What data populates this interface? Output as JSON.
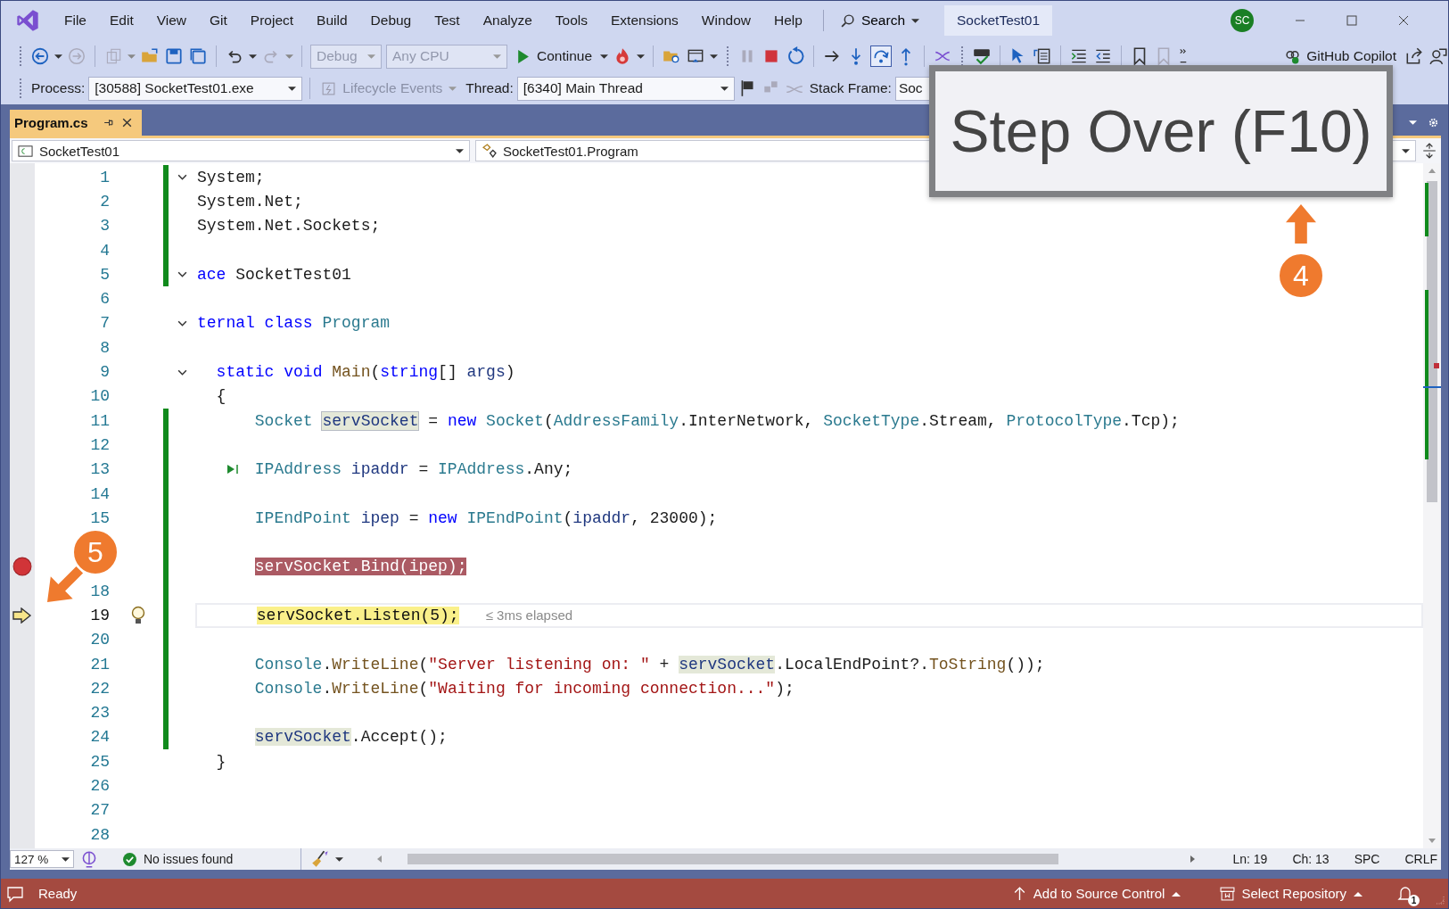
{
  "menu_bar": {
    "items": [
      "File",
      "Edit",
      "View",
      "Git",
      "Project",
      "Build",
      "Debug",
      "Test",
      "Analyze",
      "Tools",
      "Extensions",
      "Window",
      "Help"
    ],
    "search": "Search",
    "solution_name": "SocketTest01",
    "avatar": "SC"
  },
  "toolbar": {
    "configuration": {
      "text": "Debug",
      "disabled": true
    },
    "platform": {
      "text": "Any CPU",
      "disabled": true
    },
    "continue": "Continue",
    "copilot": "GitHub Copilot"
  },
  "debug_location": {
    "process_label": "Process:",
    "process": "[30588] SocketTest01.exe",
    "lifecycle": {
      "text": "Lifecycle Events",
      "disabled": true
    },
    "thread_label": "Thread:",
    "thread": "[6340] Main Thread",
    "stack_frame_label": "Stack Frame:",
    "stack_frame": "Soc"
  },
  "tabs": [
    {
      "label": "Program.cs",
      "selected": true
    }
  ],
  "navigation": {
    "project": "SocketTest01",
    "type": "SocketTest01.Program"
  },
  "lines": [
    {
      "number": "1",
      "fold": true,
      "changed": true,
      "tokens": [
        {
          "t": "System;"
        }
      ]
    },
    {
      "number": "2",
      "changed": true,
      "tokens": [
        {
          "t": "System.Net;"
        }
      ]
    },
    {
      "number": "3",
      "changed": true,
      "tokens": [
        {
          "t": "System.Net.Sockets;"
        }
      ]
    },
    {
      "number": "4",
      "changed": true
    },
    {
      "number": "5",
      "fold": true,
      "changed": true,
      "tokens": [
        {
          "t": "ace ",
          "kind": "kw"
        },
        {
          "t": "SocketTest01"
        }
      ]
    },
    {
      "number": "6"
    },
    {
      "number": "7",
      "fold": true,
      "tokens": [
        {
          "t": "ternal class ",
          "kind": "kw"
        },
        {
          "t": "Program",
          "kind": "type"
        }
      ]
    },
    {
      "number": "8"
    },
    {
      "number": "9",
      "fold": true,
      "tokens": [
        {
          "t": "  static void ",
          "kind": "kw"
        },
        {
          "t": "Main",
          "kind": "method"
        },
        {
          "t": "("
        },
        {
          "t": "string",
          "kind": "kw"
        },
        {
          "t": "[] "
        },
        {
          "t": "args",
          "kind": "var"
        },
        {
          "t": ")"
        }
      ]
    },
    {
      "number": "10",
      "tokens": [
        {
          "t": "  {"
        }
      ]
    },
    {
      "number": "11",
      "changed": true,
      "tokens": [
        {
          "t": "      Socket ",
          "kind": "type"
        },
        {
          "t": "servSocket",
          "kind": "def"
        },
        {
          "t": " = "
        },
        {
          "t": "new ",
          "kind": "kw"
        },
        {
          "t": "Socket",
          "kind": "type"
        },
        {
          "t": "("
        },
        {
          "t": "AddressFamily",
          "kind": "type"
        },
        {
          "t": ".InterNetwork, "
        },
        {
          "t": "SocketType",
          "kind": "type"
        },
        {
          "t": ".Stream, "
        },
        {
          "t": "ProtocolType",
          "kind": "type"
        },
        {
          "t": ".Tcp);"
        }
      ]
    },
    {
      "number": "12",
      "changed": true
    },
    {
      "number": "13",
      "changed": true,
      "run_to_click": true,
      "tokens": [
        {
          "t": "      IPAddress ",
          "kind": "type"
        },
        {
          "t": "ipaddr",
          "kind": "var"
        },
        {
          "t": " = "
        },
        {
          "t": "IPAddress",
          "kind": "type"
        },
        {
          "t": ".Any;"
        }
      ]
    },
    {
      "number": "14",
      "changed": true
    },
    {
      "number": "15",
      "changed": true,
      "tokens": [
        {
          "t": "      IPEndPoint ",
          "kind": "type"
        },
        {
          "t": "ipep",
          "kind": "var"
        },
        {
          "t": " = "
        },
        {
          "t": "new ",
          "kind": "kw"
        },
        {
          "t": "IPEndPoint",
          "kind": "type"
        },
        {
          "t": "("
        },
        {
          "t": "ipaddr",
          "kind": "var"
        },
        {
          "t": ", 23000);"
        }
      ]
    },
    {
      "changed": true
    },
    {
      "changed": true,
      "breakpoint": true,
      "tokens": [
        {
          "t": "      servSocket.Bind(ipep);",
          "kind": "bp"
        }
      ]
    },
    {
      "number": "18",
      "changed": true
    },
    {
      "number": "19",
      "changed": true,
      "current": true,
      "lightbulb": true,
      "hint": "≤ 3ms elapsed",
      "tokens": [
        {
          "t": "      servSocket.Listen(5);",
          "kind": "cur"
        }
      ]
    },
    {
      "number": "20",
      "changed": true
    },
    {
      "number": "21",
      "changed": true,
      "tokens": [
        {
          "t": "      Console",
          "kind": "type"
        },
        {
          "t": "."
        },
        {
          "t": "WriteLine",
          "kind": "method"
        },
        {
          "t": "("
        },
        {
          "t": "\"Server listening on: \"",
          "kind": "str"
        },
        {
          "t": " + "
        },
        {
          "t": "servSocket",
          "kind": "ref"
        },
        {
          "t": ".LocalEndPoint?."
        },
        {
          "t": "ToString",
          "kind": "method"
        },
        {
          "t": "());"
        }
      ]
    },
    {
      "number": "22",
      "changed": true,
      "tokens": [
        {
          "t": "      Console",
          "kind": "type"
        },
        {
          "t": "."
        },
        {
          "t": "WriteLine",
          "kind": "method"
        },
        {
          "t": "("
        },
        {
          "t": "\"Waiting for incoming connection...\"",
          "kind": "str"
        },
        {
          "t": ");"
        }
      ]
    },
    {
      "number": "23",
      "changed": true
    },
    {
      "number": "24",
      "changed": true,
      "tokens": [
        {
          "t": "      servSocket",
          "kind": "ref"
        },
        {
          "t": ".Accept();"
        }
      ]
    },
    {
      "number": "25",
      "tokens": [
        {
          "t": "  }"
        }
      ]
    },
    {
      "number": "26"
    },
    {
      "number": "27"
    },
    {
      "number": "28"
    }
  ],
  "editor_status": {
    "zoom": "127 %",
    "issues": "No issues found",
    "line": "Ln: 19",
    "column": "Ch: 13",
    "whitespace": "SPC",
    "line_ending": "CRLF"
  },
  "status_bar": {
    "state": "Ready",
    "source_control": "Add to Source Control",
    "repository": "Select Repository",
    "notifications": "1"
  },
  "tooltip": "Step Over (F10)",
  "callouts": [
    {
      "number": "4",
      "kind": "up"
    },
    {
      "number": "5",
      "kind": "down-left"
    }
  ]
}
